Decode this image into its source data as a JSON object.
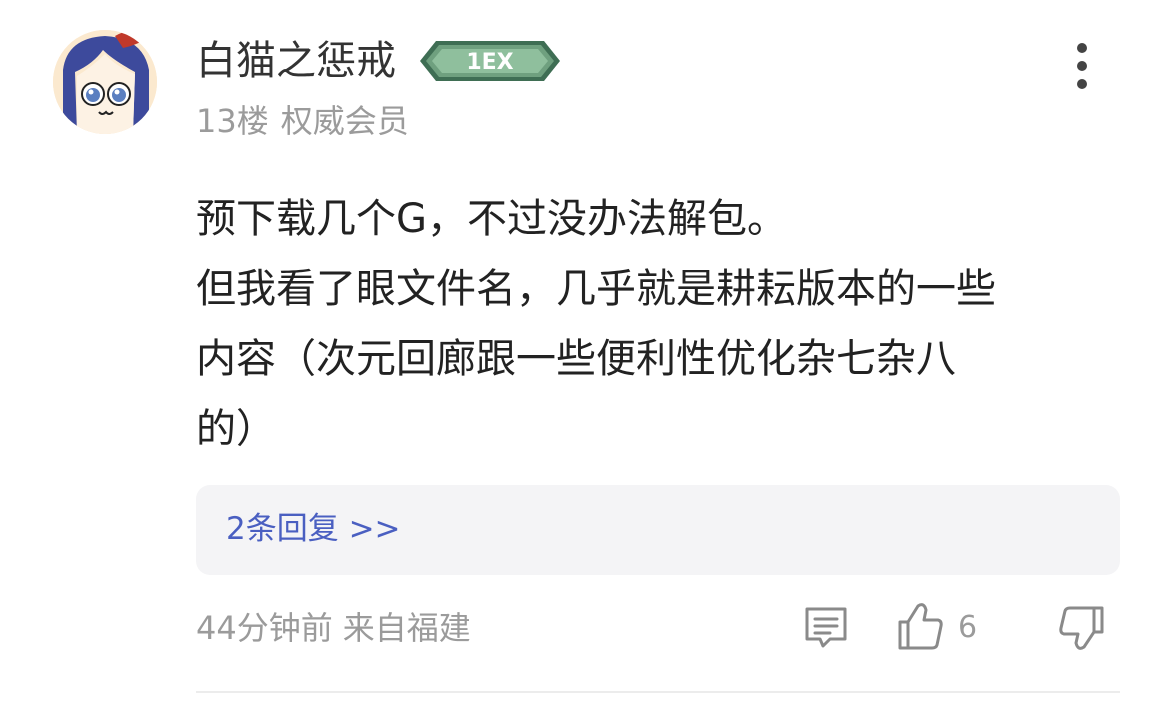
{
  "user": {
    "name": "白猫之惩戒",
    "level_badge_text": "1EX",
    "floor": "13楼",
    "role": "权威会员"
  },
  "post": {
    "lines": [
      "预下载几个G，不过没办法解包。",
      "但我看了眼文件名，几乎就是耕耘版本的一些",
      "内容（次元回廊跟一些便利性优化杂七杂八",
      "的）"
    ]
  },
  "replies": {
    "label": "2条回复 >>"
  },
  "meta": {
    "time": "44分钟前",
    "location": "来自福建"
  },
  "actions": {
    "like_count": "6"
  },
  "colors": {
    "link": "#4a5fc1",
    "muted": "#9b9b9b",
    "badge_green": "#5e8f6f",
    "reply_bg": "#f4f4f6"
  },
  "icons": [
    "more-icon",
    "comment-icon",
    "thumbs-up-icon",
    "thumbs-down-icon"
  ]
}
